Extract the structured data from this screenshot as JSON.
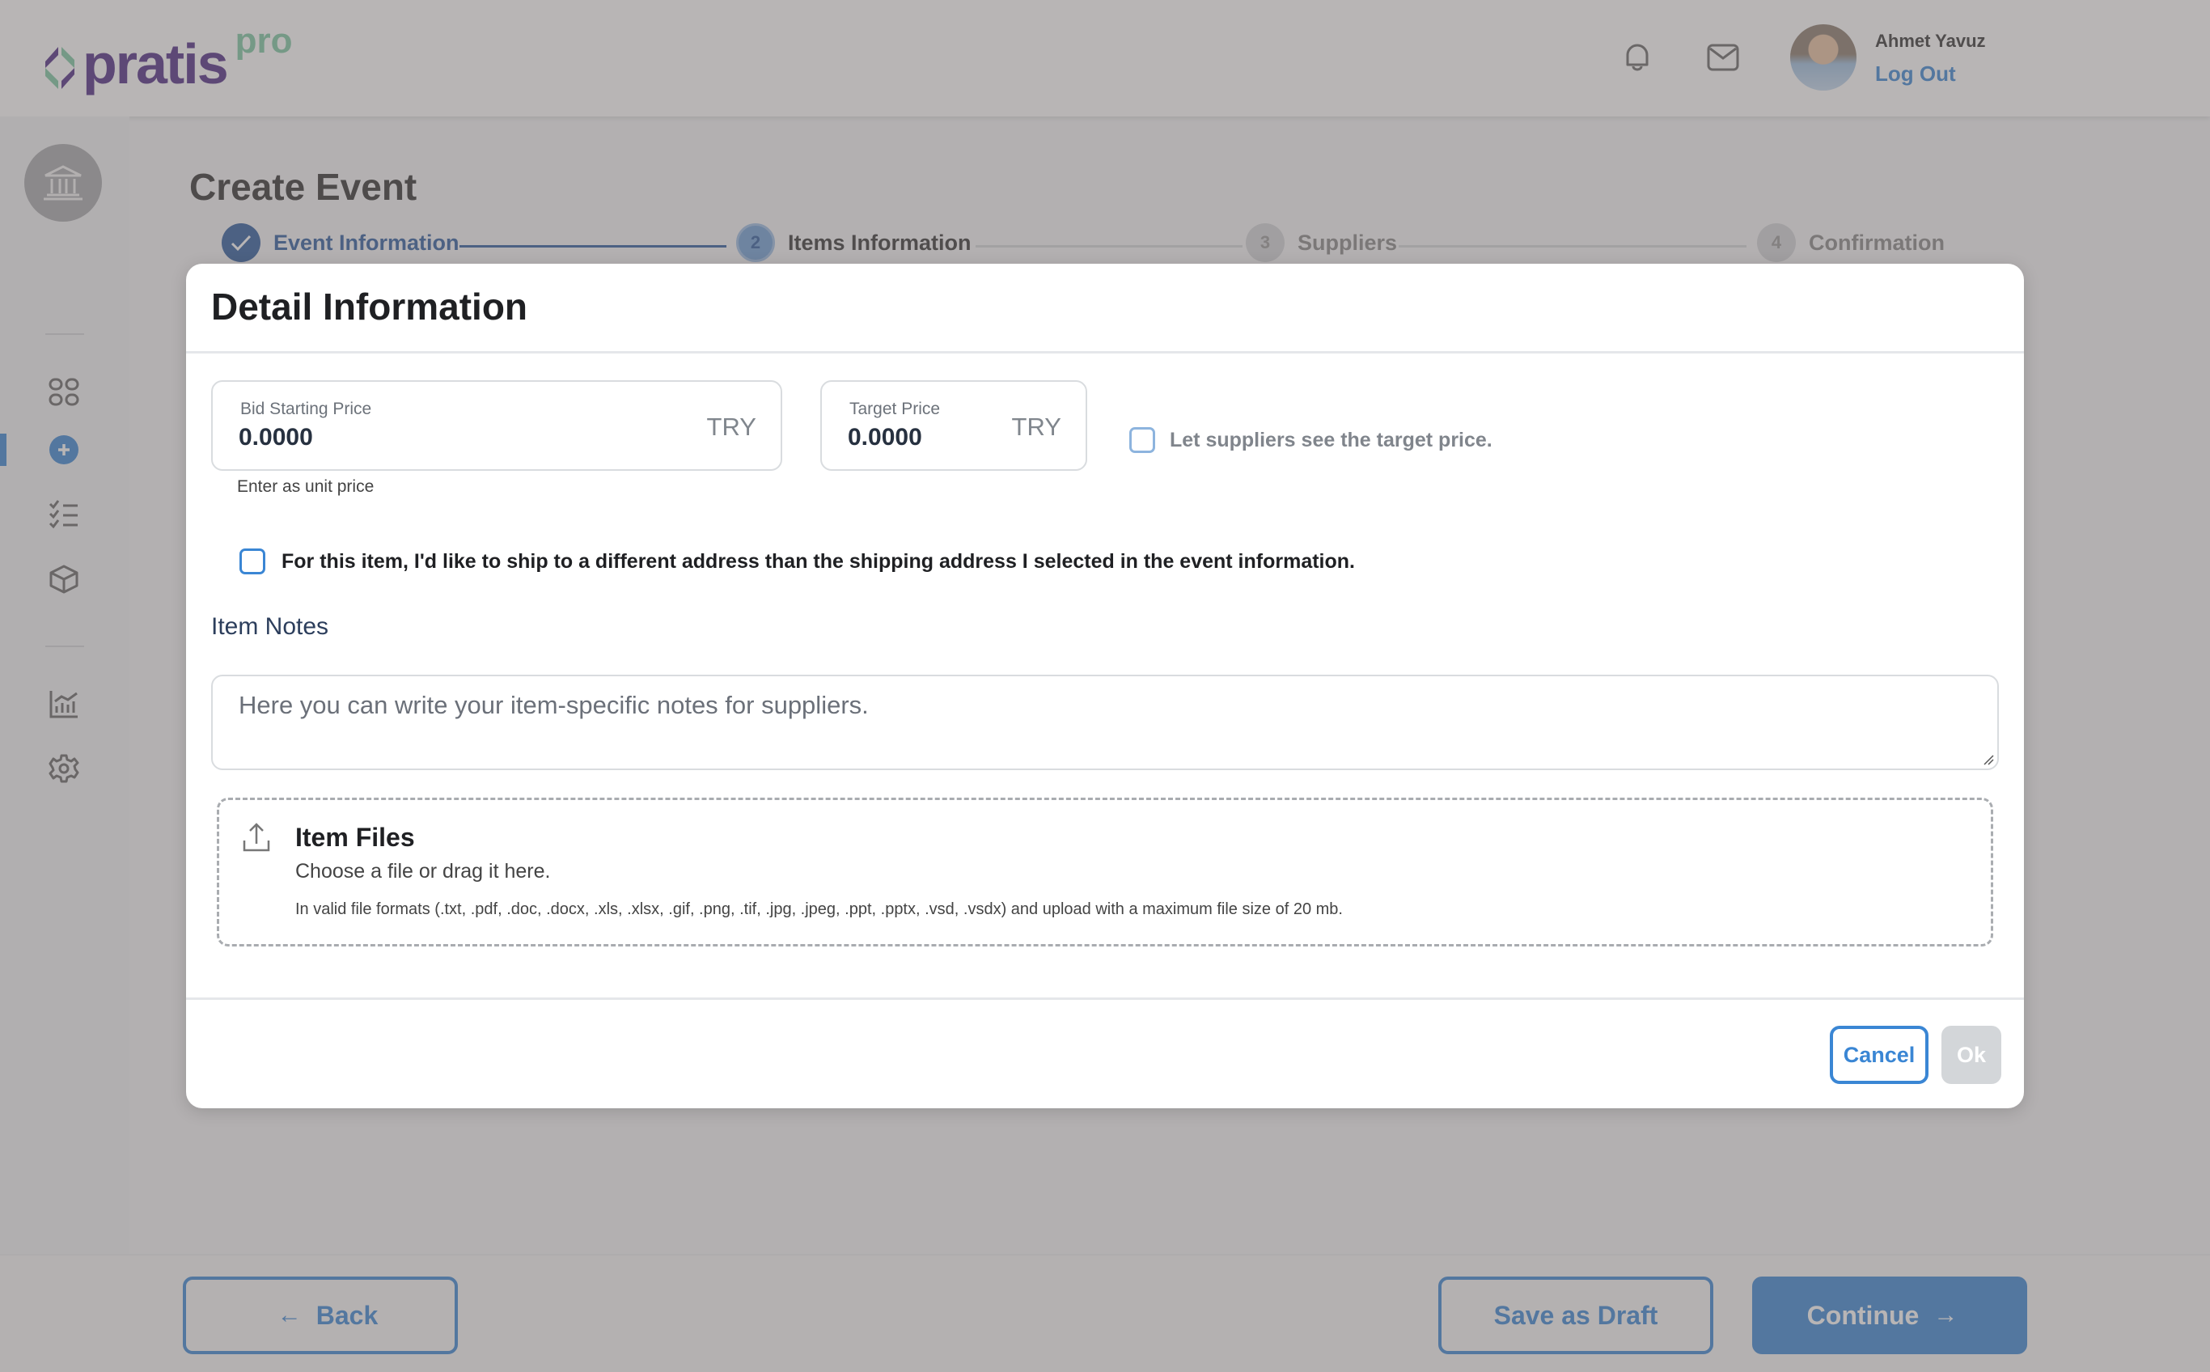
{
  "brand": {
    "name": "pratis",
    "suffix": "pro",
    "primary_color": "#3a86d4",
    "logo_purple": "#4e2a84",
    "logo_green": "#7cc8a4"
  },
  "header": {
    "icons": [
      "bell-icon",
      "mail-icon"
    ],
    "user": {
      "name": "Ahmet Yavuz",
      "logout_label": "Log Out"
    }
  },
  "sidebar": {
    "org_icon": "bank-icon",
    "items": [
      {
        "name": "dashboard",
        "icon": "grid-icon",
        "active": false
      },
      {
        "name": "create-event",
        "icon": "plus-circle-icon",
        "active": true
      },
      {
        "name": "events-list",
        "icon": "checklist-icon",
        "active": false
      },
      {
        "name": "products",
        "icon": "box-icon",
        "active": false
      },
      {
        "name": "reports",
        "icon": "chart-icon",
        "active": false
      },
      {
        "name": "settings",
        "icon": "gear-icon",
        "active": false
      }
    ]
  },
  "page": {
    "title": "Create Event",
    "steps": [
      {
        "number": "✓",
        "label": "Event Information",
        "state": "completed"
      },
      {
        "number": "2",
        "label": "Items Information",
        "state": "current"
      },
      {
        "number": "3",
        "label": "Suppliers",
        "state": "upcoming"
      },
      {
        "number": "4",
        "label": "Confirmation",
        "state": "upcoming"
      }
    ]
  },
  "footer": {
    "back_label": "Back",
    "save_draft_label": "Save as Draft",
    "continue_label": "Continue"
  },
  "modal": {
    "title": "Detail Information",
    "bid_starting_price": {
      "label": "Bid Starting Price",
      "value": "0.0000",
      "currency": "TRY",
      "helper": "Enter as unit price"
    },
    "target_price": {
      "label": "Target Price",
      "value": "0.0000",
      "currency": "TRY"
    },
    "show_target_checkbox": {
      "label": "Let suppliers see the target price.",
      "checked": false
    },
    "different_address_checkbox": {
      "label": "For this item, I'd like to ship to a different address than the shipping address I selected in the event information.",
      "checked": false
    },
    "notes": {
      "title": "Item Notes",
      "placeholder": "Here you can write your item-specific notes for suppliers.",
      "value": ""
    },
    "files": {
      "title": "Item Files",
      "subtitle": "Choose a file or drag it here.",
      "hint": "In valid file formats (.txt, .pdf, .doc, .docx, .xls, .xlsx, .gif, .png, .tif, .jpg, .jpeg, .ppt, .pptx, .vsd, .vsdx) and upload with a maximum file size of 20 mb."
    },
    "cancel_label": "Cancel",
    "ok_label": "Ok"
  }
}
